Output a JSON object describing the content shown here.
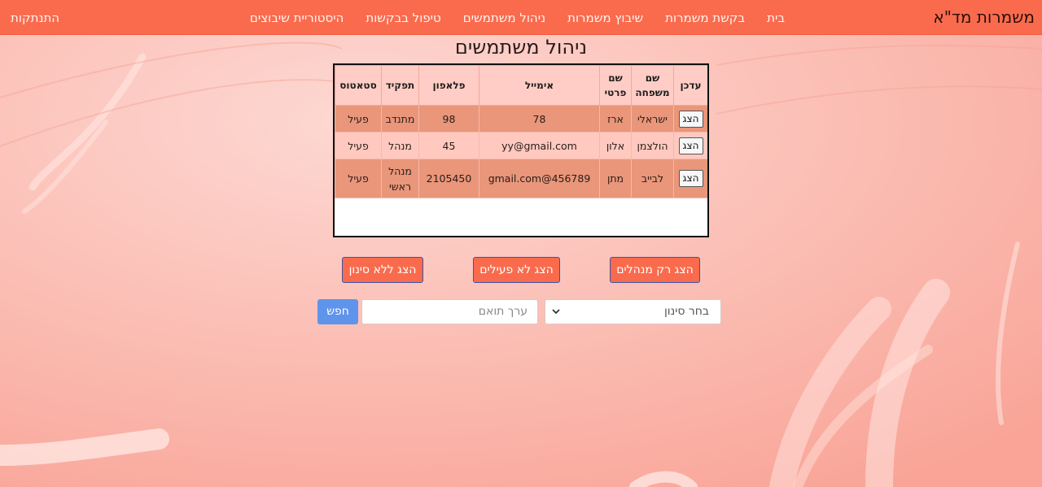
{
  "nav": {
    "brand": "משמרות מד\"א",
    "links": [
      "בית",
      "בקשת משמרות",
      "שיבוץ משמרות",
      "ניהול משתמשים",
      "טיפול בבקשות",
      "היסטוריית שיבוצים"
    ],
    "logout": "התנתקות"
  },
  "page": {
    "title": "ניהול משתמשים"
  },
  "table": {
    "headers": [
      "עדכן",
      "שם משפחה",
      "שם פרטי",
      "אימייל",
      "פלאפון",
      "תפקיד",
      "סטאטוס"
    ],
    "rows": [
      {
        "button": "הצג",
        "last": "ישראלי",
        "first": "ארז",
        "email": "78",
        "phone": "98",
        "role": "מתנדב",
        "status": "פעיל"
      },
      {
        "button": "הצג",
        "last": "הולצמן",
        "first": "אלון",
        "email": "yy@gmail.com",
        "phone": "45",
        "role": "מנהל",
        "status": "פעיל"
      },
      {
        "button": "הצג",
        "last": "לבייב",
        "first": "מתן",
        "email": "gmail.com@456789",
        "phone": "2105450",
        "role": "מנהל ראשי",
        "status": "פעיל"
      }
    ]
  },
  "filters": {
    "managers_only": "הצג רק מנהלים",
    "inactive": "הצג לא פעילים",
    "no_filter": "הצג ללא סינון"
  },
  "search": {
    "select_value": "בחר סינון",
    "input_placeholder": "ערך תואם",
    "button": "חפש"
  }
}
